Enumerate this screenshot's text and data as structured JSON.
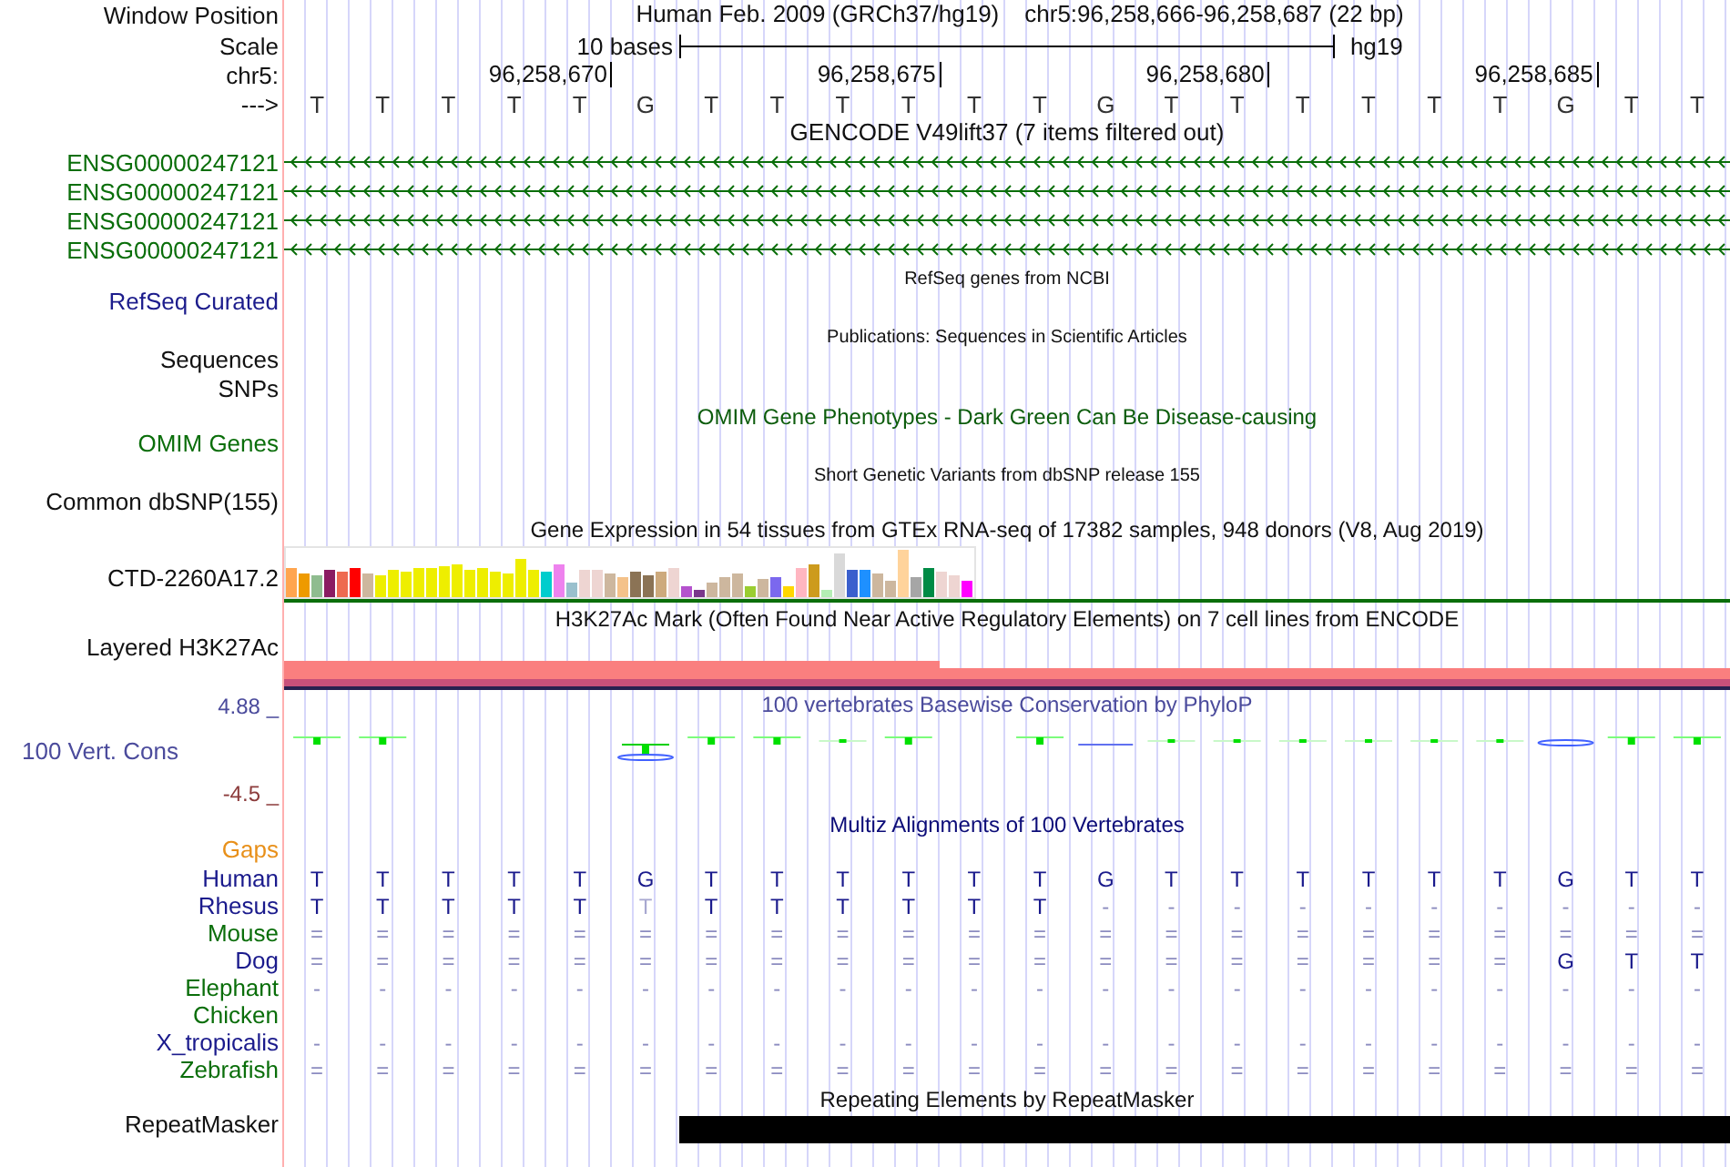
{
  "header_labels": {
    "window_position": "Window Position",
    "scale": "Scale",
    "chromosome": "chr5:",
    "strand": "--->"
  },
  "title": {
    "assembly": "Human Feb. 2009 (GRCh37/hg19)",
    "region": "chr5:96,258,666-96,258,687 (22 bp)"
  },
  "scale": {
    "span": "10 bases",
    "assembly": "hg19"
  },
  "positions": [
    "96,258,670",
    "96,258,675",
    "96,258,680",
    "96,258,685"
  ],
  "bases": [
    "T",
    "T",
    "T",
    "T",
    "T",
    "G",
    "T",
    "T",
    "T",
    "T",
    "T",
    "T",
    "G",
    "T",
    "T",
    "T",
    "T",
    "T",
    "T",
    "G",
    "T",
    "T"
  ],
  "gencode": {
    "title": "GENCODE V49lift37 (7 items filtered out)",
    "items": [
      {
        "name": "ENSG00000247121"
      },
      {
        "name": "ENSG00000247121"
      },
      {
        "name": "ENSG00000247121"
      },
      {
        "name": "ENSG00000247121"
      }
    ]
  },
  "refseq": {
    "title": "RefSeq genes from NCBI",
    "label": "RefSeq Curated"
  },
  "publications": {
    "title": "Publications: Sequences in Scientific Articles",
    "labels": [
      "Sequences",
      "SNPs"
    ]
  },
  "omim": {
    "title": "OMIM Gene Phenotypes - Dark Green Can Be Disease-causing",
    "label": "OMIM Genes"
  },
  "dbsnp": {
    "title": "Short Genetic Variants from dbSNP release 155",
    "label": "Common dbSNP(155)"
  },
  "gtex": {
    "title": "Gene Expression in 54 tissues from GTEx RNA-seq of 17382 samples, 948 donors (V8, Aug 2019)",
    "label": "CTD-2260A17.2"
  },
  "h3k27ac": {
    "title": "H3K27Ac Mark (Often Found Near Active Regulatory Elements) on 7 cell lines from ENCODE",
    "label": "Layered H3K27Ac"
  },
  "phylop": {
    "title": "100 vertebrates Basewise Conservation by PhyloP",
    "label": "100 Vert. Cons",
    "max": "4.88 _",
    "min": "-4.5 _"
  },
  "multiz": {
    "title": "Multiz Alignments of 100 Vertebrates",
    "gaps_label": "Gaps",
    "species": [
      {
        "name": "Human",
        "color": "#1a1a8c",
        "bases": [
          "T",
          "T",
          "T",
          "T",
          "T",
          "G",
          "T",
          "T",
          "T",
          "T",
          "T",
          "T",
          "G",
          "T",
          "T",
          "T",
          "T",
          "T",
          "T",
          "G",
          "T",
          "T"
        ]
      },
      {
        "name": "Rhesus",
        "color": "#1a1a8c",
        "bases": [
          "T",
          "T",
          "T",
          "T",
          "T",
          "T",
          "T",
          "T",
          "T",
          "T",
          "T",
          "T",
          "-",
          "-",
          "-",
          "-",
          "-",
          "-",
          "-",
          "-",
          "-",
          "-"
        ],
        "faded": [
          false,
          false,
          false,
          false,
          false,
          true,
          false,
          false,
          false,
          false,
          false,
          false,
          false,
          false,
          false,
          false,
          false,
          false,
          false,
          false,
          false,
          false
        ]
      },
      {
        "name": "Mouse",
        "color": "#0a6e0a",
        "bases": [
          "=",
          "=",
          "=",
          "=",
          "=",
          "=",
          "=",
          "=",
          "=",
          "=",
          "=",
          "=",
          "=",
          "=",
          "=",
          "=",
          "=",
          "=",
          "=",
          "=",
          "=",
          "="
        ]
      },
      {
        "name": "Dog",
        "color": "#1a1a8c",
        "bases": [
          "=",
          "=",
          "=",
          "=",
          "=",
          "=",
          "=",
          "=",
          "=",
          "=",
          "=",
          "=",
          "=",
          "=",
          "=",
          "=",
          "=",
          "=",
          "=",
          "G",
          "T",
          "T"
        ]
      },
      {
        "name": "Elephant",
        "color": "#0a6e0a",
        "bases": [
          "-",
          "-",
          "-",
          "-",
          "-",
          "-",
          "-",
          "-",
          "-",
          "-",
          "-",
          "-",
          "-",
          "-",
          "-",
          "-",
          "-",
          "-",
          "-",
          "-",
          "-",
          "-"
        ]
      },
      {
        "name": "Chicken",
        "color": "#0a6e0a"
      },
      {
        "name": "X_tropicalis",
        "color": "#1a1a8c",
        "bases": [
          "-",
          "-",
          "-",
          "-",
          "-",
          "-",
          "-",
          "-",
          "-",
          "-",
          "-",
          "-",
          "-",
          "-",
          "-",
          "-",
          "-",
          "-",
          "-",
          "-",
          "-",
          "-"
        ]
      },
      {
        "name": "Zebrafish",
        "color": "#0a6e0a",
        "bases": [
          "=",
          "=",
          "=",
          "=",
          "=",
          "=",
          "=",
          "=",
          "=",
          "=",
          "=",
          "=",
          "=",
          "=",
          "=",
          "=",
          "=",
          "=",
          "=",
          "=",
          "=",
          "="
        ]
      }
    ]
  },
  "repeatmasker": {
    "title": "Repeating Elements by RepeatMasker",
    "label": "RepeatMasker"
  }
}
